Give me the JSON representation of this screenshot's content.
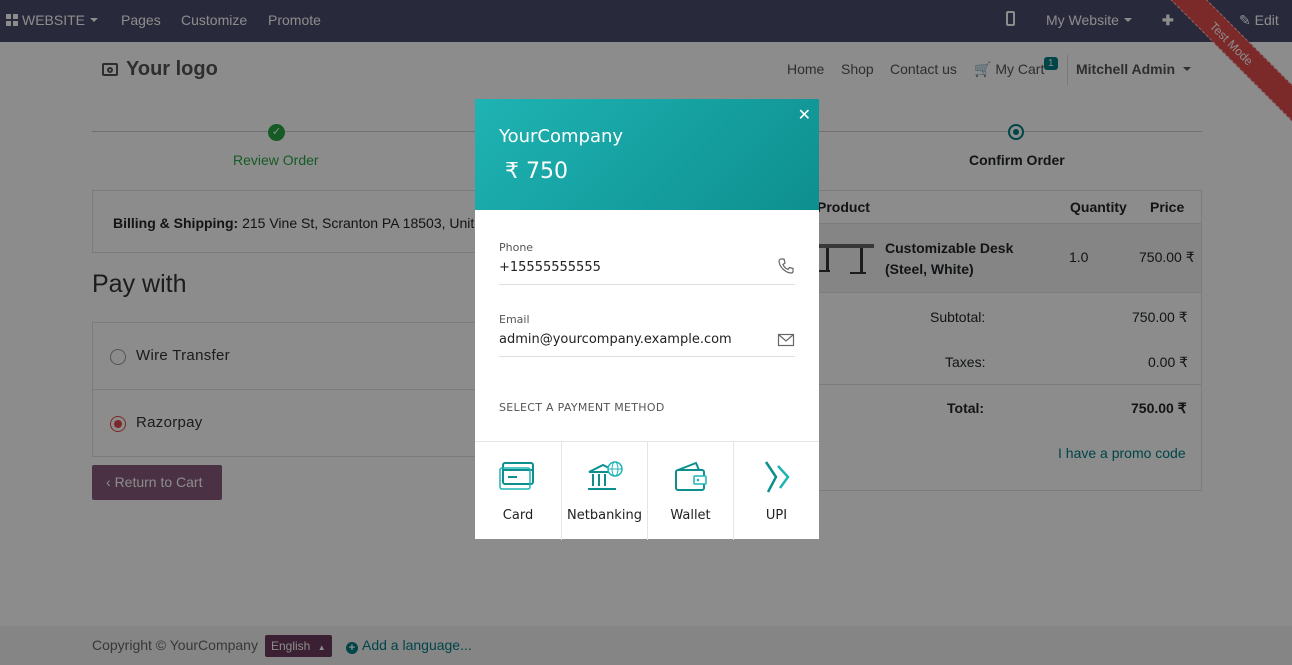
{
  "adminbar": {
    "website_menu": "WEBSITE",
    "pages": "Pages",
    "customize": "Customize",
    "promote": "Promote",
    "my_website": "My Website",
    "edit": "Edit",
    "test_mode": "Test Mode",
    "color": "#4b4b6e"
  },
  "header": {
    "logo": "Your logo",
    "nav": {
      "home": "Home",
      "shop": "Shop",
      "contact": "Contact us",
      "cart": "My Cart",
      "cart_count": "1",
      "user": "Mitchell Admin"
    }
  },
  "wizard": {
    "step1": "Review Order",
    "step3": "Confirm Order"
  },
  "billing": {
    "label": "Billing & Shipping:",
    "address": "215 Vine St, Scranton PA 18503, United States"
  },
  "payment": {
    "title": "Pay with",
    "options": [
      {
        "name": "Wire Transfer",
        "selected": false
      },
      {
        "name": "Razorpay",
        "selected": true
      }
    ],
    "return_button": "Return to Cart"
  },
  "order": {
    "headers": {
      "product": "Product",
      "quantity": "Quantity",
      "price": "Price"
    },
    "line": {
      "name_line1": "Customizable Desk",
      "name_line2": "(Steel, White)",
      "quantity": "1.0",
      "price": "750.00 ₹"
    },
    "subtotal_label": "Subtotal:",
    "subtotal": "750.00 ₹",
    "taxes_label": "Taxes:",
    "taxes": "0.00 ₹",
    "total_label": "Total:",
    "total": "750.00 ₹",
    "promo": "I have a promo code"
  },
  "footer": {
    "copyright": "Copyright © YourCompany",
    "language": "English",
    "add_language": "Add a language..."
  },
  "modal": {
    "company": "YourCompany",
    "amount": "₹ 750",
    "phone_label": "Phone",
    "phone": "+15555555555",
    "email_label": "Email",
    "email": "admin@yourcompany.example.com",
    "methods_title": "SELECT A PAYMENT METHOD",
    "methods": [
      "Card",
      "Netbanking",
      "Wallet",
      "UPI"
    ],
    "accent": "#1fb3b3"
  }
}
